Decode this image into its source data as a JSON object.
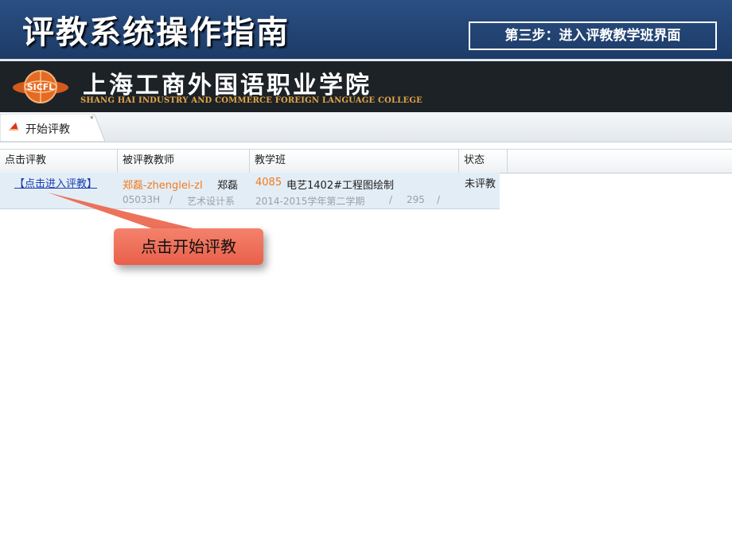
{
  "slide": {
    "title": "评教系统操作指南",
    "step": "第三步：进入评教教学班界面"
  },
  "banner": {
    "logo_text": "SICFL",
    "college_cn": "上海工商外国语职业学院",
    "college_en": "SHANG HAI INDUSTRY AND COMMERCE FOREIGN LANGUAGE COLLEGE"
  },
  "tab": {
    "label": "开始评教",
    "icon": "triangle-flag-icon",
    "marker": "*"
  },
  "grid": {
    "columns": [
      "点击评教",
      "被评教教师",
      "教学班",
      "状态"
    ],
    "rows": [
      {
        "action_link": "【点击进入评教】",
        "teacher_account": "郑磊-zhenglei-zl",
        "teacher_name": "郑磊",
        "teacher_id": "05033H",
        "sep1": "/",
        "department": "艺术设计系",
        "class_id": "4085",
        "class_name": "电艺1402#工程图绘制",
        "term": "2014-2015学年第二学期",
        "sep2": "/",
        "count": "295",
        "sep3": "/",
        "status": "未评教"
      }
    ]
  },
  "callout": {
    "text": "点击开始评教"
  },
  "colors": {
    "title_bg": "#1c3a66",
    "banner_bg": "#1d2227",
    "callout": "#ec6a52",
    "highlight": "#f07a1c",
    "link": "#1a3db0"
  }
}
